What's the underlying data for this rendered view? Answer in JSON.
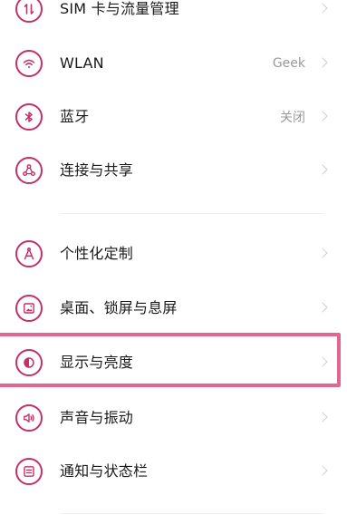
{
  "settings": {
    "items": [
      {
        "label": "SIM 卡与流量管理",
        "value": "",
        "icon": "sim-data-icon"
      },
      {
        "label": "WLAN",
        "value": "Geek",
        "icon": "wifi-icon"
      },
      {
        "label": "蓝牙",
        "value": "关闭",
        "icon": "bluetooth-icon"
      },
      {
        "label": "连接与共享",
        "value": "",
        "icon": "share-icon"
      },
      {
        "label": "个性化定制",
        "value": "",
        "icon": "personalize-icon"
      },
      {
        "label": "桌面、锁屏与息屏",
        "value": "",
        "icon": "wallpaper-icon"
      },
      {
        "label": "显示与亮度",
        "value": "",
        "icon": "brightness-icon"
      },
      {
        "label": "声音与振动",
        "value": "",
        "icon": "sound-icon"
      },
      {
        "label": "通知与状态栏",
        "value": "",
        "icon": "notification-icon"
      }
    ]
  },
  "colors": {
    "icon": "#c4316a",
    "highlight": "#e2668f",
    "secondary_text": "#9a9a9a"
  }
}
